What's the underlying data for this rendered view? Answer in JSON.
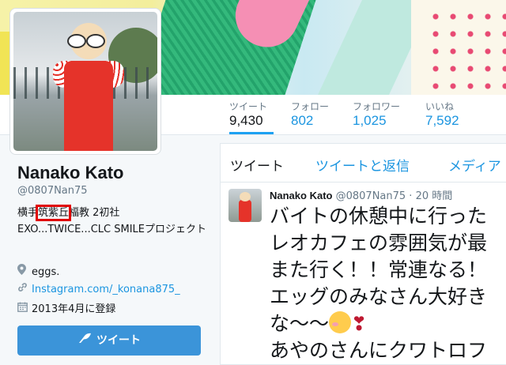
{
  "stats": [
    {
      "label": "ツイート",
      "value": "9,430"
    },
    {
      "label": "フォロー",
      "value": "802"
    },
    {
      "label": "フォロワー",
      "value": "1,025"
    },
    {
      "label": "いいね",
      "value": "7,592"
    }
  ],
  "profile": {
    "name": "Nanako Kato",
    "handle": "@0807Nan75",
    "bio_pre": "横手",
    "bio_highlight": "筑紫丘",
    "bio_post": "福教 2初社 EXO...TWICE...CLC SMILEプロジェクト",
    "location": "eggs.",
    "link": "Instagram.com/_konana875_",
    "joined": "2013年4月に登録",
    "tweet_button": "ツイート"
  },
  "icons": {
    "location": "map-pin-icon",
    "link": "link-icon",
    "calendar": "calendar-icon",
    "quill": "quill-icon"
  },
  "timeline": {
    "tabs": [
      "ツイート",
      "ツイートと返信",
      "メディア"
    ],
    "tweet": {
      "name": "Nanako Kato",
      "handle_time": "@0807Nan75 · 20 時間",
      "lines": [
        "バイトの休憩中に行った",
        "レオカフェの雰囲気が最",
        "また行く！！常連なる！",
        "エッグのみなさん大好き",
        "な〜〜",
        "あやのさんにクワトロフ"
      ]
    }
  },
  "colors": {
    "accent": "#1da1f2",
    "link": "#1b95e0",
    "button": "#3b94d9",
    "highlight": "#e00000"
  }
}
